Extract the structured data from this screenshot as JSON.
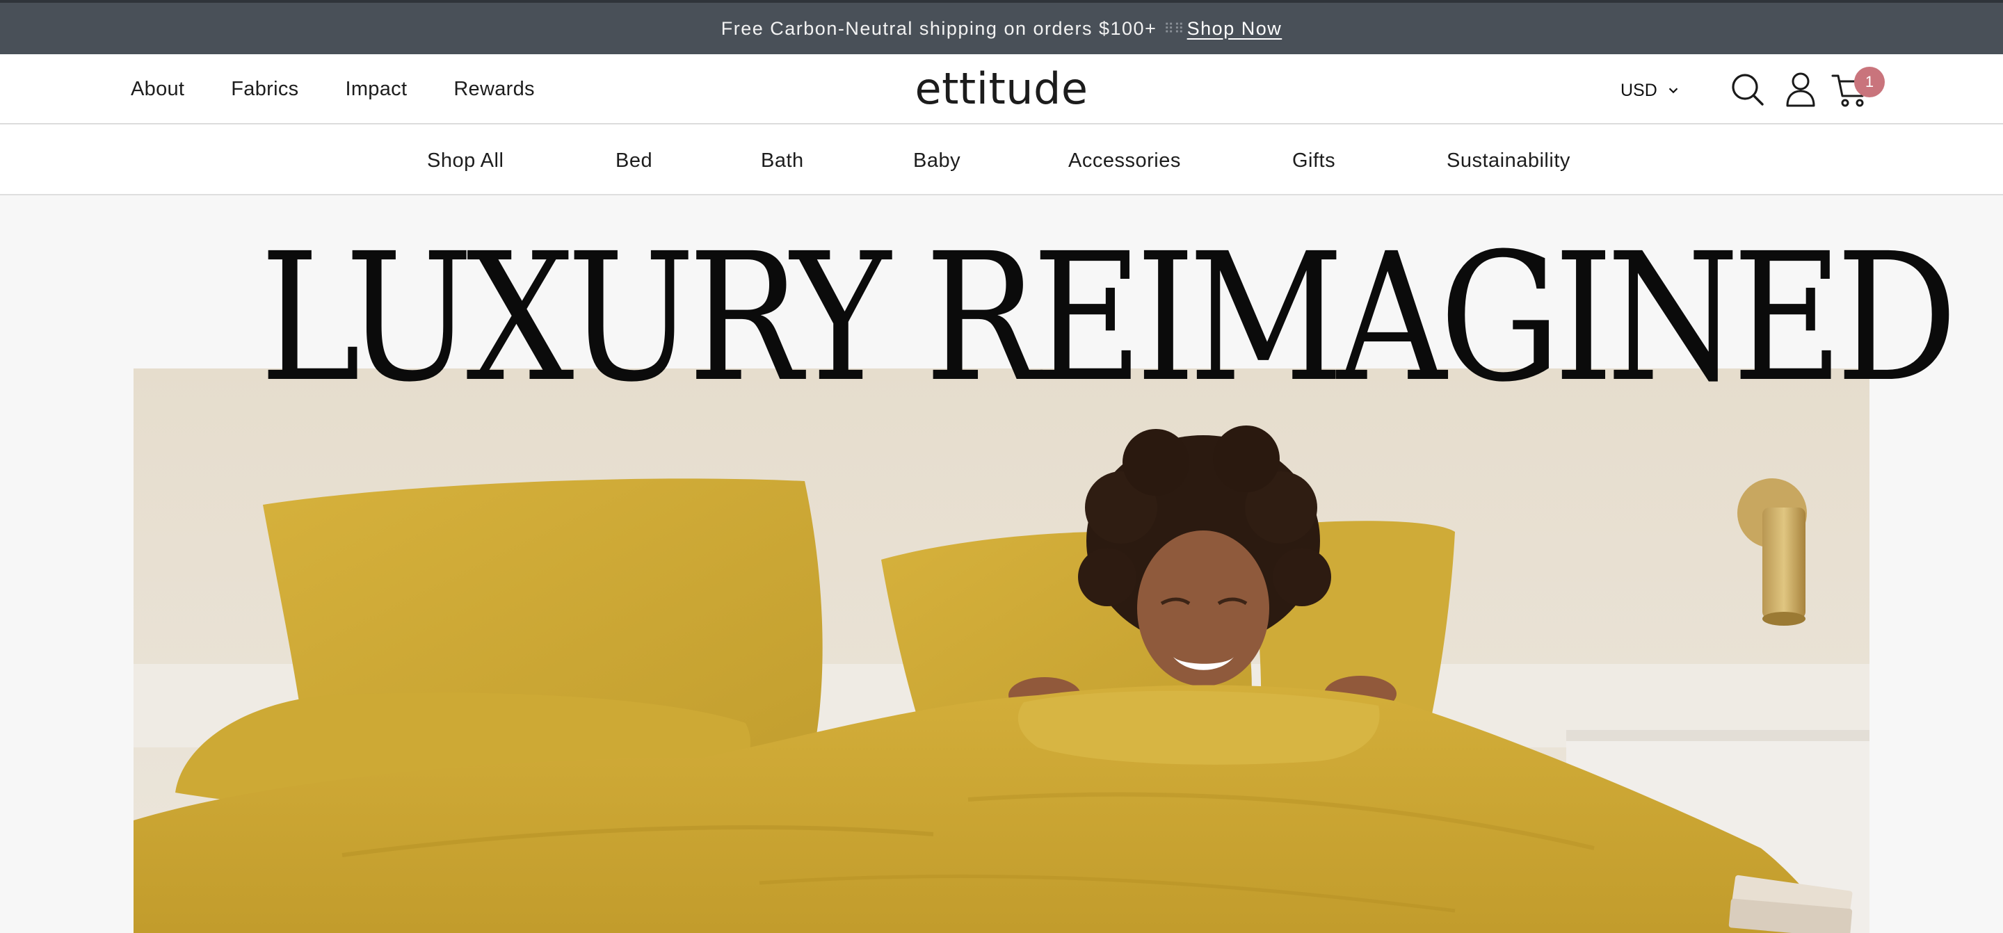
{
  "announcement": {
    "text": "Free Carbon-Neutral shipping on orders $100+",
    "separator": "⠿⠿",
    "link": "Shop Now"
  },
  "header": {
    "nav": [
      "About",
      "Fabrics",
      "Impact",
      "Rewards"
    ],
    "logo": "ettitude",
    "currency": "USD",
    "icons": [
      "search-icon",
      "account-icon",
      "cart-icon",
      "chevron-down-icon"
    ],
    "cart_count": "1",
    "badge_color": "#c9747c"
  },
  "categories": [
    "Shop All",
    "Bed",
    "Bath",
    "Baby",
    "Accessories",
    "Gifts",
    "Sustainability"
  ],
  "hero": {
    "title": "LUXURY REIMAGINED"
  },
  "colors": {
    "announcement_bg": "#495058",
    "bedding": "#c9a532",
    "page_bg": "#f7f7f7"
  }
}
